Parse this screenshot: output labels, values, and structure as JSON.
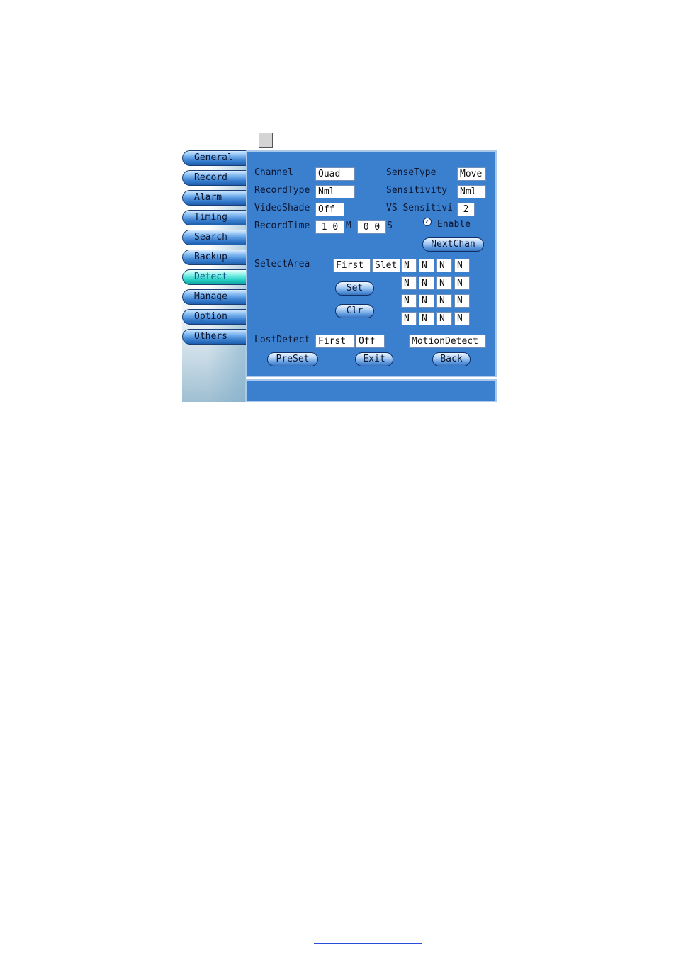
{
  "nav": {
    "items": [
      {
        "label": "General"
      },
      {
        "label": "Record"
      },
      {
        "label": "Alarm"
      },
      {
        "label": "Timing"
      },
      {
        "label": "Search"
      },
      {
        "label": "Backup"
      },
      {
        "label": "Detect",
        "active": true
      },
      {
        "label": "Manage"
      },
      {
        "label": "Option"
      },
      {
        "label": "Others"
      }
    ]
  },
  "form": {
    "channel_label": "Channel",
    "channel_value": "Quad",
    "record_type_label": "RecordType",
    "record_type_value": "Nml",
    "video_shade_label": "VideoShade",
    "video_shade_value": "Off",
    "record_time_label": "RecordTime",
    "record_time_min": "1 0",
    "record_time_min_unit": "M",
    "record_time_sec": "0 0",
    "record_time_sec_unit": "S",
    "sense_type_label": "SenseType",
    "sense_type_value": "Move",
    "sensitivity_label": "Sensitivity",
    "sensitivity_value": "Nml",
    "vs_sensitivity_label": "VS Sensitivi",
    "vs_sensitivity_value": "2",
    "enable_label": "Enable",
    "enable_checked": true,
    "next_chan_label": "NextChan",
    "select_area_label": "SelectArea",
    "select_area_first": "First",
    "select_area_slet": "Slet",
    "set_label": "Set",
    "clr_label": "Clr",
    "grid": [
      [
        "N",
        "N",
        "N",
        "N"
      ],
      [
        "N",
        "N",
        "N",
        "N"
      ],
      [
        "N",
        "N",
        "N",
        "N"
      ],
      [
        "N",
        "N",
        "N",
        "N"
      ]
    ],
    "lost_detect_label": "LostDetect",
    "lost_detect_first": "First",
    "lost_detect_value": "Off",
    "motion_detect_label": "MotionDetect",
    "preset_label": "PreSet",
    "exit_label": "Exit",
    "back_label": "Back"
  },
  "status_bar": {
    "text": ""
  }
}
